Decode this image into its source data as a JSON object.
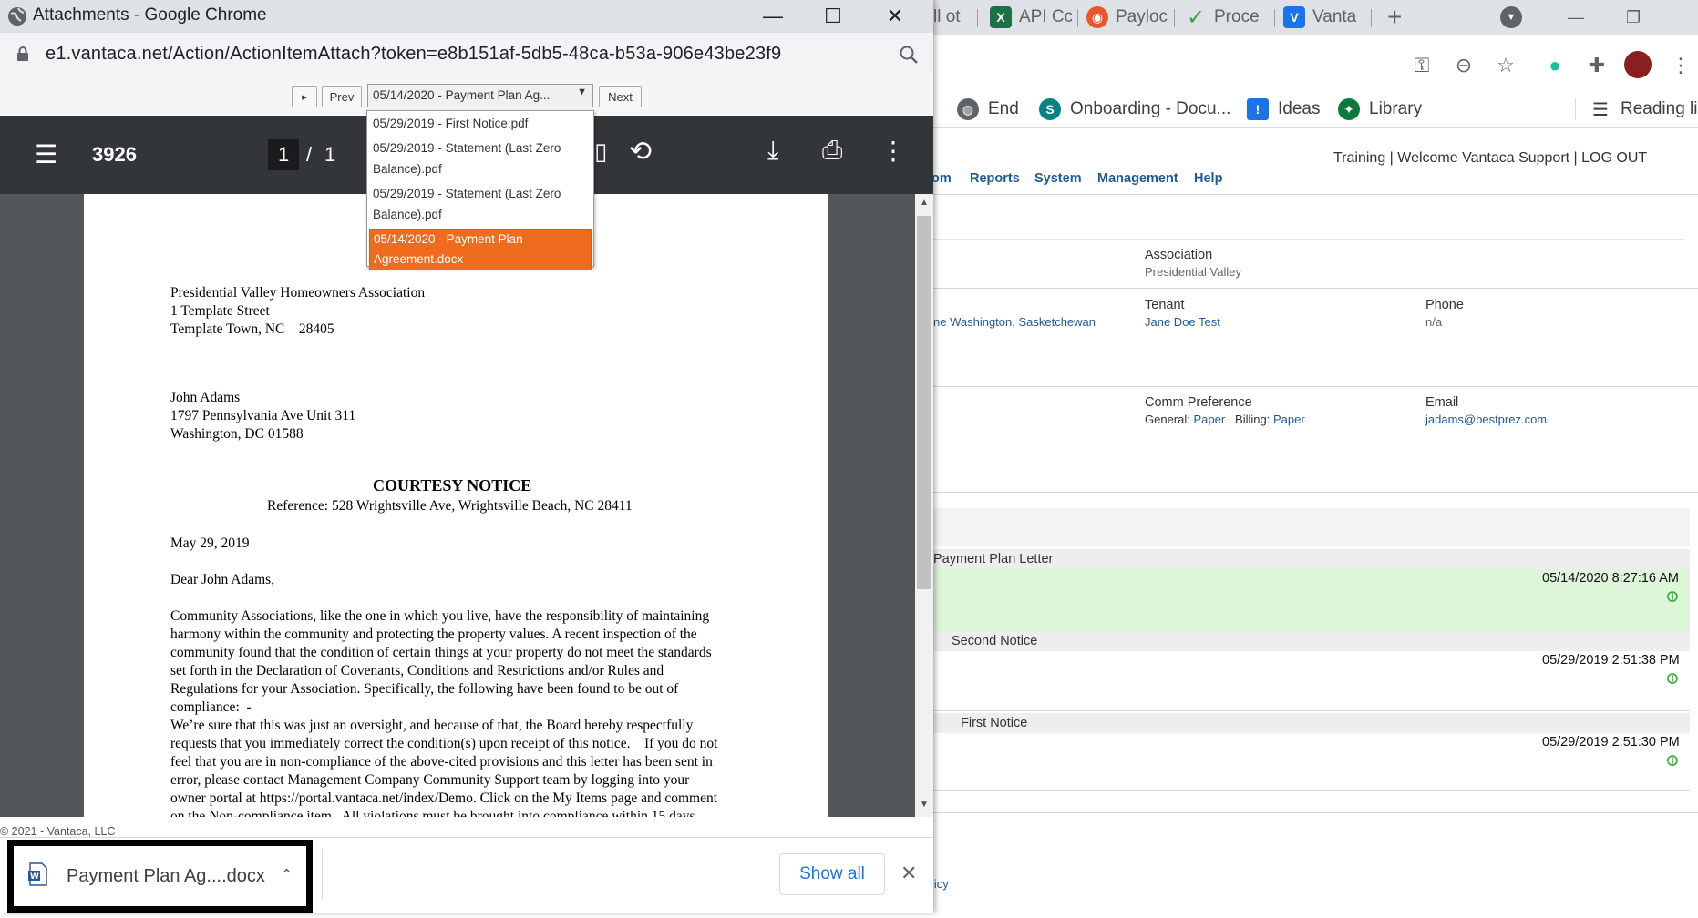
{
  "popup": {
    "window_title": "Attachments - Google Chrome",
    "url": "e1.vantaca.net/Action/ActionItemAttach?token=e8b151af-5db5-48ca-b53a-906e43be23f9",
    "controls": {
      "play_glyph": "▸",
      "prev_label": "Prev",
      "selected_file": "05/14/2020 - Payment Plan Ag...",
      "next_label": "Next",
      "options": [
        "05/29/2019 - First Notice.pdf",
        "05/29/2019 - Statement (Last Zero",
        "Balance).pdf",
        "05/29/2019 - Statement (Last Zero",
        "Balance).pdf",
        "05/14/2020 - Payment Plan",
        "Agreement.docx"
      ]
    },
    "pdf_toolbar": {
      "doc_id": "3926",
      "page_current": "1",
      "page_sep": "/",
      "page_total": "1"
    },
    "document": {
      "sender_lines": "Presidential Valley Homeowners Association\n1 Template Street\nTemplate Town, NC    28405",
      "recipient_lines": "John Adams\n1797 Pennsylvania Ave Unit 311\nWashington, DC 01588",
      "heading": "COURTESY NOTICE",
      "reference": "Reference: 528 Wrightsville Ave, Wrightsville Beach, NC 28411",
      "date": "May 29, 2019",
      "salutation": "Dear John Adams,",
      "body": "Community Associations, like the one in which you live, have the responsibility of maintaining\nharmony within the community and protecting the property values. A recent inspection of the\ncommunity found that the condition of certain things at your property do not meet the standards\nset forth in the Declaration of Covenants, Conditions and Restrictions and/or Rules and\nRegulations for your Association. Specifically, the following have been found to be out of\ncompliance:  -\nWe’re sure that this was just an oversight, and because of that, the Board hereby respectfully\nrequests that you immediately correct the condition(s) upon receipt of this notice.    If you do not\nfeel that you are in non-compliance of the above-cited provisions and this letter has been sent in\nerror, please contact Management Company Community Support team by logging into your\nowner portal at https://portal.vantaca.net/index/Demo. Click on the My Items page and comment\non the Non-compliance item.  All violations must be brought into compliance within 15 days"
    },
    "copyright": "© 2021 - Vantaca, LLC",
    "download": {
      "file_name": "Payment Plan Ag....docx",
      "show_all": "Show all"
    }
  },
  "background": {
    "tabs": [
      {
        "label": "ll ot",
        "color": ""
      },
      {
        "label": "API Cc",
        "color": "#1e7145"
      },
      {
        "label": "Payloc",
        "color": "#e8562a"
      },
      {
        "label": "Proce",
        "color": "#3aa335"
      },
      {
        "label": "Vanta",
        "color": "#1a73e8"
      }
    ],
    "bookmarks": [
      {
        "label": "End"
      },
      {
        "label": "Onboarding - Docu..."
      },
      {
        "label": "Ideas"
      },
      {
        "label": "Library"
      },
      {
        "label": "Reading lis"
      }
    ],
    "top_links": "Training | Welcome Vantaca Support |  LOG OUT",
    "nav": [
      "om",
      "Reports",
      "System",
      "Management",
      "Help"
    ],
    "fields": {
      "association_label": "Association",
      "association_value": "Presidential Valley",
      "address_partial": "ne Washington, Sasketchewan",
      "tenant_label": "Tenant",
      "tenant_value": "Jane Doe Test",
      "phone_label": "Phone",
      "phone_value": "n/a",
      "comm_label": "Comm Preference",
      "comm_general_label": "General:",
      "comm_general_value": "Paper",
      "comm_billing_label": "Billing:",
      "comm_billing_value": "Paper",
      "email_label": "Email",
      "email_value": "jadams@bestprez.com"
    },
    "history": [
      {
        "title": "Payment Plan Letter",
        "stamp": "05/14/2020 8:27:16 AM",
        "highlight": true
      },
      {
        "title": "Second Notice",
        "stamp": "05/29/2019 2:51:38 PM",
        "highlight": false
      },
      {
        "title": "First Notice",
        "stamp": "05/29/2019 2:51:30 PM",
        "highlight": false
      }
    ],
    "footer_partial": "licy"
  }
}
